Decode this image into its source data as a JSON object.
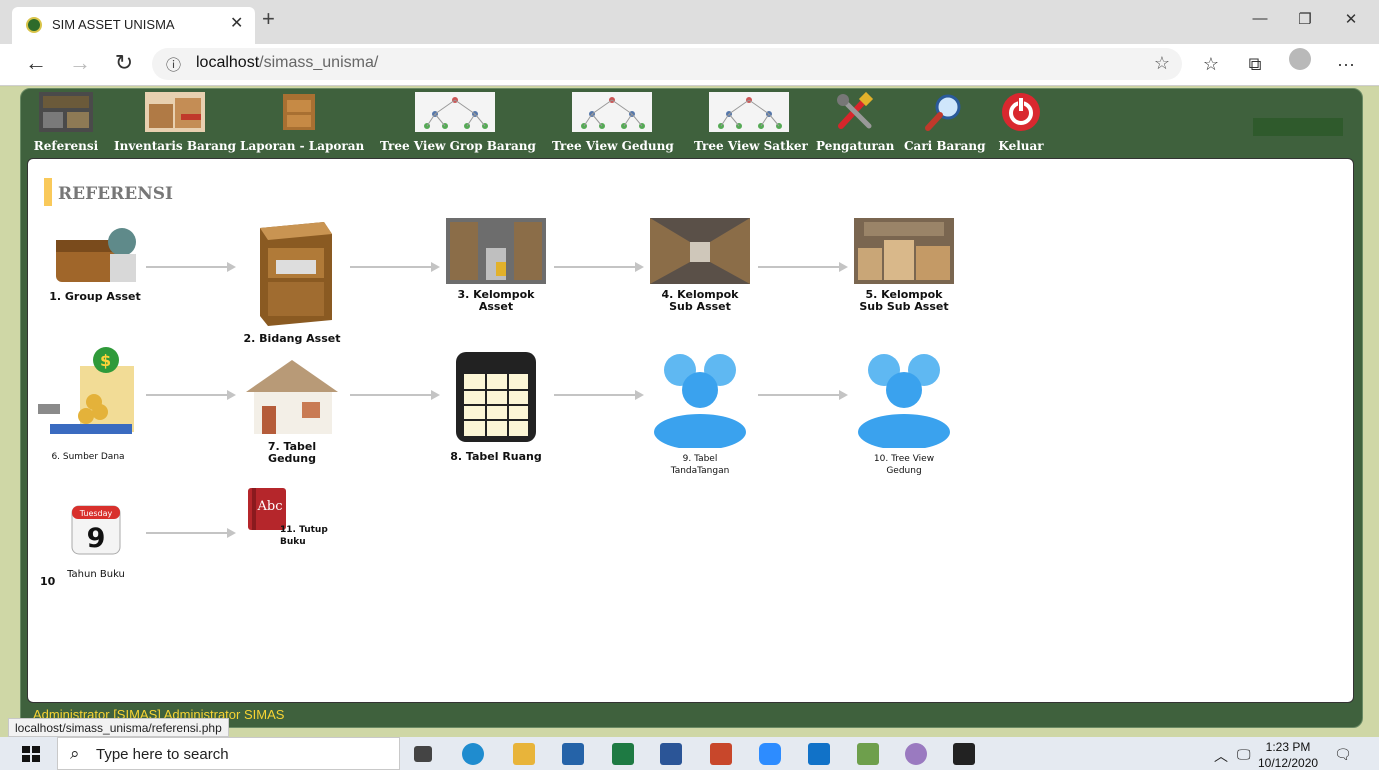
{
  "browser": {
    "tab_title": "SIM ASSET UNISMA",
    "url_host": "localhost",
    "url_path": "/simass_unisma/",
    "status_tip": "localhost/simass_unisma/referensi.php"
  },
  "menu": [
    {
      "label": "Referensi"
    },
    {
      "label": "Inventaris Barang"
    },
    {
      "label": "Laporan - Laporan"
    },
    {
      "label": "Tree View Grop Barang"
    },
    {
      "label": "Tree View Gedung"
    },
    {
      "label": "Tree View Satker"
    },
    {
      "label": "Pengaturan"
    },
    {
      "label": "Cari Barang"
    },
    {
      "label": "Keluar"
    }
  ],
  "section_title": "REFERENSI",
  "references": [
    {
      "label": "1. Group Asset"
    },
    {
      "label": "2. Bidang Asset"
    },
    {
      "label": "3. Kelompok\nAsset"
    },
    {
      "label": "4. Kelompok\nSub Asset"
    },
    {
      "label": "5. Kelompok\nSub Sub Asset"
    },
    {
      "label": "6. Sumber Dana"
    },
    {
      "label": "7. Tabel\nGedung"
    },
    {
      "label": "8. Tabel Ruang"
    },
    {
      "label": "9. Tabel\nTandaTangan"
    },
    {
      "label": "10. Tree View\nGedung"
    },
    {
      "label": "11. Tutup\nBuku"
    },
    {
      "label": "Tahun Buku",
      "number": "10"
    }
  ],
  "calendar": {
    "day_name": "Tuesday",
    "day": "9"
  },
  "book_text": "Abc",
  "footer_text": "Administrator [SIMAS] Administrator SIMAS",
  "taskbar": {
    "search_placeholder": "Type here to search",
    "time": "1:23 PM",
    "date": "10/12/2020"
  },
  "colors": {
    "frame": "#3f613d",
    "accent_yellow": "#f9c95a",
    "footer_text": "#f7d334"
  }
}
